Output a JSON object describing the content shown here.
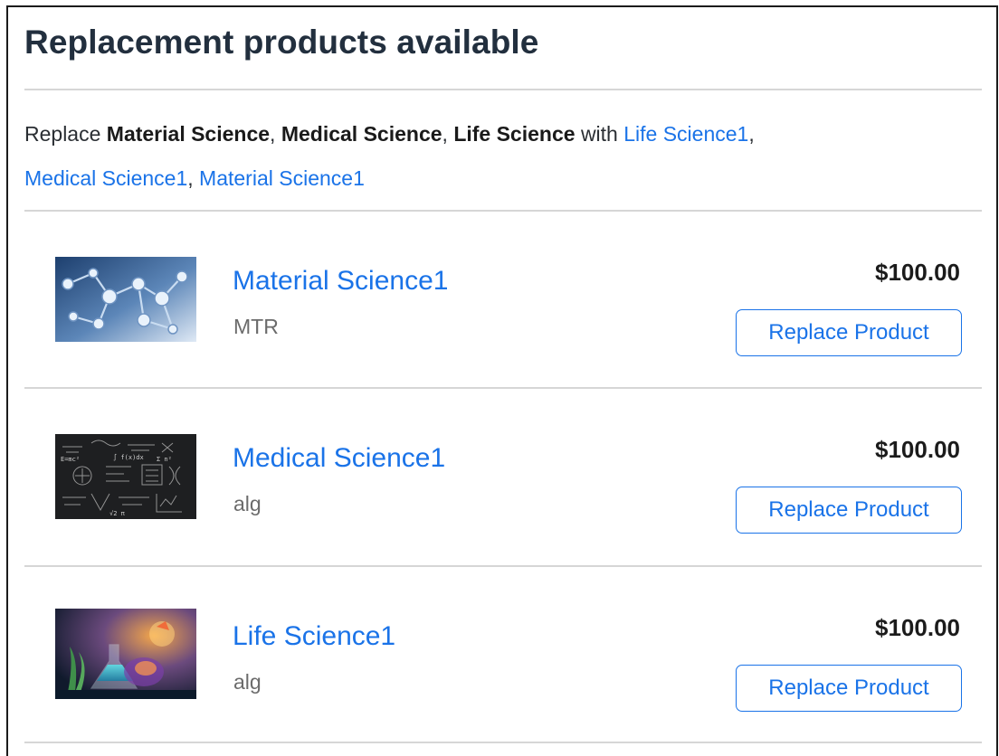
{
  "header": {
    "title": "Replacement products available"
  },
  "summary": {
    "prefix": "Replace",
    "replaced": [
      "Material Science",
      "Medical Science",
      "Life Science"
    ],
    "connector": "with",
    "replacements": [
      "Life Science1",
      "Medical Science1",
      "Material Science1"
    ]
  },
  "products": [
    {
      "name": "Material Science1",
      "code": "MTR",
      "price": "$100.00",
      "button_label": "Replace Product",
      "image": "molecule-structure-image"
    },
    {
      "name": "Medical Science1",
      "code": "alg",
      "price": "$100.00",
      "button_label": "Replace Product",
      "image": "chalkboard-formulas-image"
    },
    {
      "name": "Life Science1",
      "code": "alg",
      "price": "$100.00",
      "button_label": "Replace Product",
      "image": "laboratory-flask-image"
    }
  ]
}
